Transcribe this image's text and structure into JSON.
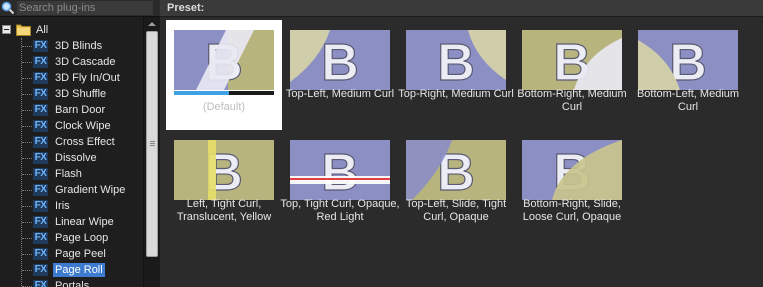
{
  "search": {
    "placeholder": "Search plug-ins",
    "icon": "search-icon"
  },
  "tree": {
    "root_label": "All",
    "items": [
      {
        "label": "3D Blinds"
      },
      {
        "label": "3D Cascade"
      },
      {
        "label": "3D Fly In/Out"
      },
      {
        "label": "3D Shuffle"
      },
      {
        "label": "Barn Door"
      },
      {
        "label": "Clock Wipe"
      },
      {
        "label": "Cross Effect"
      },
      {
        "label": "Dissolve"
      },
      {
        "label": "Flash"
      },
      {
        "label": "Gradient Wipe"
      },
      {
        "label": "Iris"
      },
      {
        "label": "Linear Wipe"
      },
      {
        "label": "Page Loop"
      },
      {
        "label": "Page Peel"
      },
      {
        "label": "Page Roll",
        "selected": true
      },
      {
        "label": "Portals"
      }
    ],
    "fx_badge": "FX"
  },
  "preset_header": "Preset:",
  "presets": [
    {
      "label": "(Default)",
      "selected": true,
      "progress": 0.55
    },
    {
      "label": "Top-Left, Medium Curl"
    },
    {
      "label": "Top-Right, Medium Curl"
    },
    {
      "label": "Bottom-Right, Medium Curl"
    },
    {
      "label": "Bottom-Left, Medium Curl"
    },
    {
      "label": "Left, Tight Curl, Translucent, Yellow"
    },
    {
      "label": "Top, Tight Curl, Opaque, Red Light"
    },
    {
      "label": "Top-Left, Slide, Tight Curl, Opaque"
    },
    {
      "label": "Bottom-Right, Slide, Loose Curl, Opaque"
    }
  ],
  "colors": {
    "selection": "#3d7bd0",
    "fx_icon": "#6fb4ff",
    "progress": "#3ea1e4",
    "thumb_blue": "#8b8fc4",
    "thumb_khaki": "#b8b47e"
  }
}
